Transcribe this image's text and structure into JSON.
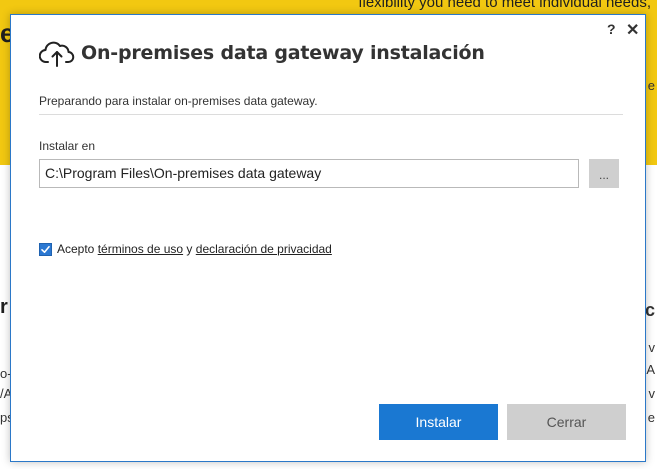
{
  "background": {
    "banner_text": "flexibility you need to meet individual needs,",
    "edge_e": "e",
    "edge_r": "r",
    "right_letters": [
      "e",
      "c",
      "v",
      "A",
      "v",
      "e"
    ],
    "left_fragments": [
      "o-I",
      "/A",
      "ps"
    ]
  },
  "dialog": {
    "title": "On-premises data gateway instalación",
    "help_label": "?",
    "close_label": "✕",
    "status_text": "Preparando para instalar on-premises data gateway.",
    "install_label": "Instalar en",
    "install_path": "C:\\Program Files\\On-premises data gateway",
    "browse_label": "...",
    "terms": {
      "checked": true,
      "prefix": "Acepto ",
      "terms_link": "términos de uso",
      "conjunction": " y ",
      "privacy_link": "declaración de privacidad"
    },
    "install_button": "Instalar",
    "cancel_button": "Cerrar"
  },
  "colors": {
    "banner": "#f2c811",
    "accent": "#1a78d2",
    "secondary_button": "#cfcfcf"
  }
}
